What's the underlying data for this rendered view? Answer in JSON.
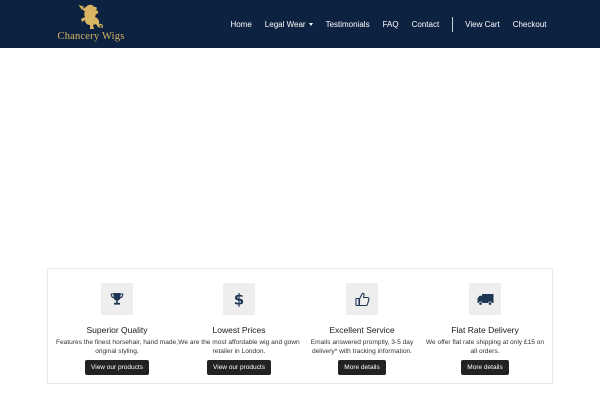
{
  "brand": {
    "name": "Chancery Wigs",
    "logo_icon": "lion-rampant-icon",
    "name_color": "#d9b563"
  },
  "nav": {
    "links": [
      {
        "label": "Home"
      },
      {
        "label": "Legal Wear",
        "has_dropdown": true
      },
      {
        "label": "Testimonials"
      },
      {
        "label": "FAQ"
      },
      {
        "label": "Contact"
      }
    ],
    "right_links": [
      {
        "label": "View Cart"
      },
      {
        "label": "Checkout"
      }
    ],
    "background": "#0d2240"
  },
  "features": [
    {
      "icon": "trophy-icon",
      "title": "Superior Quality",
      "text": "Features the finest horsehair, hand made, original styling.",
      "button": "View our products"
    },
    {
      "icon": "dollar-icon",
      "title": "Lowest Prices",
      "text": "We are the most affordable wig and gown retailer in London.",
      "button": "View our products"
    },
    {
      "icon": "thumbs-up-icon",
      "title": "Excellent Service",
      "text": "Emails answered promptly, 3-5 day delivery* with tracking information.",
      "button": "More details"
    },
    {
      "icon": "truck-icon",
      "title": "Flat Rate Delivery",
      "text": "We offer flat rate shipping at only £15 on all orders.",
      "button": "More details"
    }
  ]
}
